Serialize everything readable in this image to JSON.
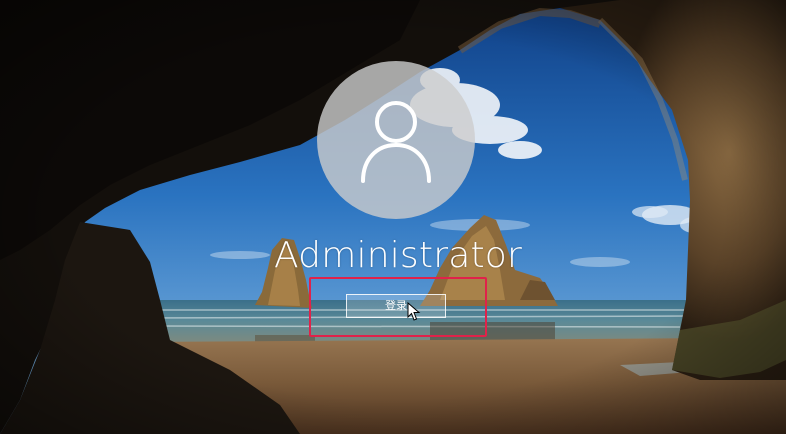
{
  "login": {
    "username": "Administrator",
    "signin_label": "登录"
  },
  "icons": {
    "avatar": "user-silhouette-icon",
    "cursor": "mouse-pointer-icon"
  },
  "colors": {
    "highlight": "#e0224a",
    "text": "#ffffff",
    "avatar_fill": "#cdcdcd"
  }
}
